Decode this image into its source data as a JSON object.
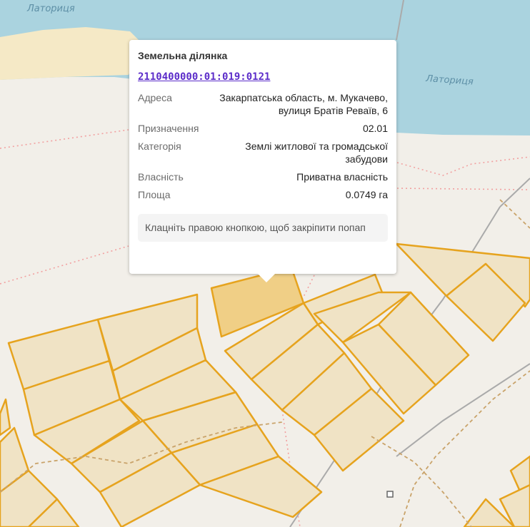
{
  "map": {
    "water_label_1": "Латориця",
    "water_label_2": "Латориця",
    "colors": {
      "water": "#aad3df",
      "sand": "#f5e9c6",
      "land": "#f2efe9",
      "parcel_fill": "#f0e3c5",
      "parcel_border": "#e6a31e",
      "selected_parcel_fill": "#f0cf86",
      "boundary_dotted": "#f2a0a0",
      "path_dashed": "#c9a36a",
      "rail": "#aaaaaa"
    }
  },
  "popup": {
    "title": "Земельна ділянка",
    "cadastral_number": "2110400000:01:019:0121",
    "fields": [
      {
        "label": "Адреса",
        "value": "Закарпатська область, м. Мукачево, вулиця Братів Реваїв, 6"
      },
      {
        "label": "Призначення",
        "value": "02.01"
      },
      {
        "label": "Категорія",
        "value": "Землі житлової та громадської забудови"
      },
      {
        "label": "Власність",
        "value": "Приватна власність"
      },
      {
        "label": "Площа",
        "value": "0.0749 га"
      }
    ],
    "hint": "Клацніть правою кнопкою, щоб закріпити попап"
  }
}
